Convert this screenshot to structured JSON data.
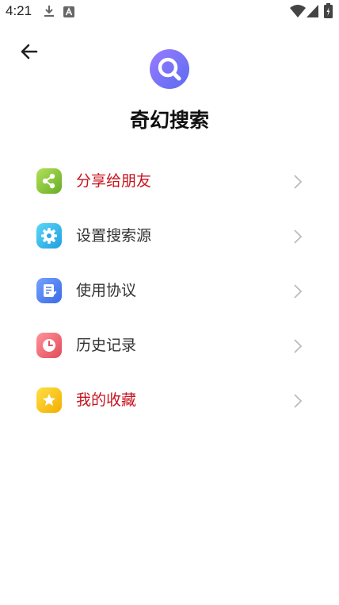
{
  "status_bar": {
    "time": "4:21",
    "icons": [
      "download-icon",
      "a-badge-icon",
      "wifi-icon",
      "signal-icon",
      "battery-icon"
    ]
  },
  "header": {
    "back_icon": "arrow-left-icon",
    "app_name": "奇幻搜索",
    "logo_icon": "search-logo-icon"
  },
  "menu": {
    "items": [
      {
        "label": "分享给朋友",
        "icon": "share-icon",
        "label_color": "#c8141e",
        "icon_colors": [
          "#a6d94a",
          "#6cb12a"
        ]
      },
      {
        "label": "设置搜索源",
        "icon": "settings-gear-icon",
        "label_color": "#333333",
        "icon_colors": [
          "#4fd0f4",
          "#27a8e6"
        ]
      },
      {
        "label": "使用协议",
        "icon": "document-edit-icon",
        "label_color": "#333333",
        "icon_colors": [
          "#6a9bff",
          "#3d6fe8"
        ]
      },
      {
        "label": "历史记录",
        "icon": "clock-icon",
        "label_color": "#333333",
        "icon_colors": [
          "#ff8a93",
          "#e8525f"
        ]
      },
      {
        "label": "我的收藏",
        "icon": "star-icon",
        "label_color": "#c8141e",
        "icon_colors": [
          "#ffd83a",
          "#f5b400"
        ]
      }
    ]
  }
}
